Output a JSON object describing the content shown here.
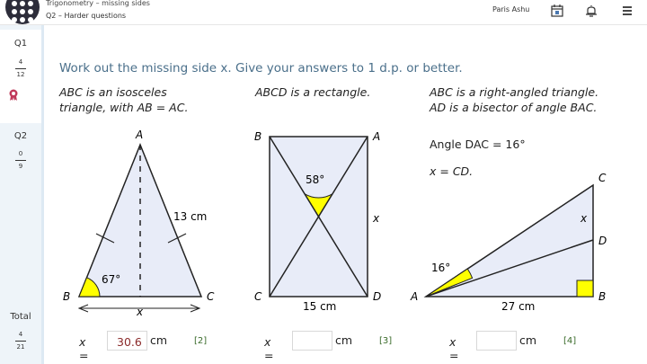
{
  "header": {
    "title": "Trigonometry – missing sides",
    "subtitle": "Q2 – Harder questions",
    "user": "Paris Ashu"
  },
  "sidebar": {
    "questions": [
      {
        "label": "Q1",
        "numerator": "4",
        "denominator": "12"
      },
      {
        "label": "Q2",
        "numerator": "0",
        "denominator": "9"
      }
    ],
    "total": {
      "label": "Total",
      "numerator": "4",
      "denominator": "21"
    }
  },
  "main": {
    "instruction": "Work out the missing side x. Give your answers to 1 d.p. or better.",
    "parts": [
      {
        "line1": "ABC is an isosceles",
        "line2": "triangle, with AB = AC.",
        "labels": {
          "A": "A",
          "B": "B",
          "C": "C",
          "side": "13 cm",
          "angle": "67°",
          "x": "x"
        },
        "answer_label": "x =",
        "answer_value": "30.6",
        "unit": "cm",
        "marks": "[2]"
      },
      {
        "line1": "ABCD is a rectangle.",
        "labels": {
          "A": "A",
          "B": "B",
          "C": "C",
          "D": "D",
          "bottom": "15 cm",
          "angle": "58°",
          "x": "x"
        },
        "answer_label": "x =",
        "answer_value": "",
        "unit": "cm",
        "marks": "[3]"
      },
      {
        "line1": "ABC is a right-angled triangle.",
        "line2": "AD is a bisector of angle BAC.",
        "extra1": "Angle DAC = 16°",
        "extra2": "x = CD.",
        "labels": {
          "A": "A",
          "B": "B",
          "C": "C",
          "D": "D",
          "bottom": "27 cm",
          "angle": "16°",
          "x": "x"
        },
        "answer_label": "x =",
        "answer_value": "",
        "unit": "cm",
        "marks": "[4]"
      }
    ]
  },
  "colors": {
    "fill": "#e8ecf8",
    "angle": "#ffff00",
    "instruction": "#4a6f8a",
    "marks": "#3a6b2a",
    "answer": "#8a2a2a"
  }
}
